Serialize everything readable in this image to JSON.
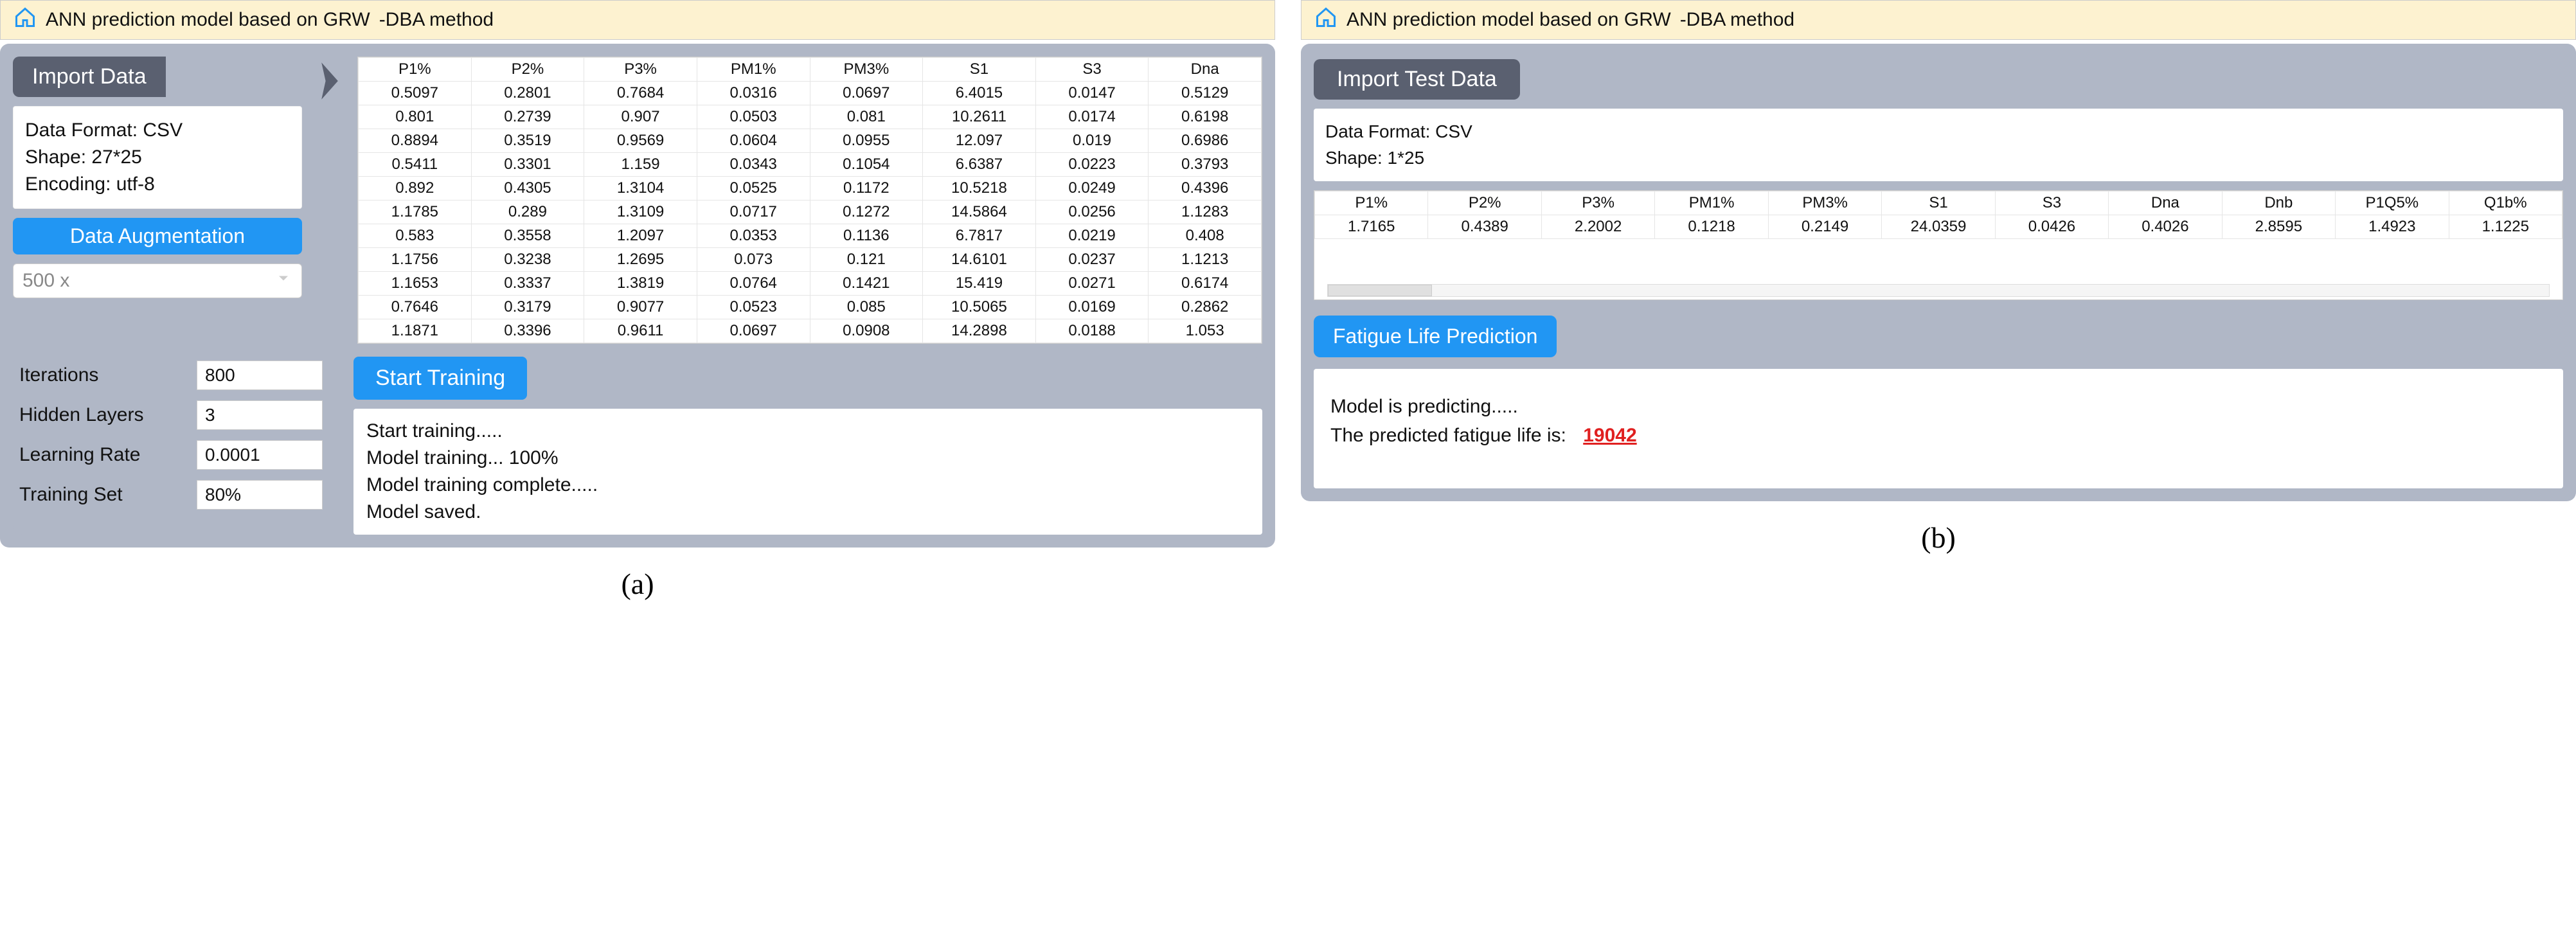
{
  "titlebarA": {
    "prefix": "ANN prediction model based on GRW",
    "suffix": "-DBA method"
  },
  "titlebarB": {
    "prefix": "ANN prediction model based on GRW",
    "suffix": "-DBA method"
  },
  "panelA": {
    "import_btn": "Import Data",
    "info": {
      "format_label": "Data Format: ",
      "format_value": "CSV",
      "shape_label": "Shape: ",
      "shape_value": "27*25",
      "encoding_label": "Encoding: ",
      "encoding_value": "utf-8"
    },
    "augment_btn": "Data Augmentation",
    "augment_value": "500 x",
    "table": {
      "headers": [
        "P1%",
        "P2%",
        "P3%",
        "PM1%",
        "PM3%",
        "S1",
        "S3",
        "Dna"
      ],
      "rows": [
        [
          "0.5097",
          "0.2801",
          "0.7684",
          "0.0316",
          "0.0697",
          "6.4015",
          "0.0147",
          "0.5129"
        ],
        [
          "0.801",
          "0.2739",
          "0.907",
          "0.0503",
          "0.081",
          "10.2611",
          "0.0174",
          "0.6198"
        ],
        [
          "0.8894",
          "0.3519",
          "0.9569",
          "0.0604",
          "0.0955",
          "12.097",
          "0.019",
          "0.6986"
        ],
        [
          "0.5411",
          "0.3301",
          "1.159",
          "0.0343",
          "0.1054",
          "6.6387",
          "0.0223",
          "0.3793"
        ],
        [
          "0.892",
          "0.4305",
          "1.3104",
          "0.0525",
          "0.1172",
          "10.5218",
          "0.0249",
          "0.4396"
        ],
        [
          "1.1785",
          "0.289",
          "1.3109",
          "0.0717",
          "0.1272",
          "14.5864",
          "0.0256",
          "1.1283"
        ],
        [
          "0.583",
          "0.3558",
          "1.2097",
          "0.0353",
          "0.1136",
          "6.7817",
          "0.0219",
          "0.408"
        ],
        [
          "1.1756",
          "0.3238",
          "1.2695",
          "0.073",
          "0.121",
          "14.6101",
          "0.0237",
          "1.1213"
        ],
        [
          "1.1653",
          "0.3337",
          "1.3819",
          "0.0764",
          "0.1421",
          "15.419",
          "0.0271",
          "0.6174"
        ],
        [
          "0.7646",
          "0.3179",
          "0.9077",
          "0.0523",
          "0.085",
          "10.5065",
          "0.0169",
          "0.2862"
        ],
        [
          "1.1871",
          "0.3396",
          "0.9611",
          "0.0697",
          "0.0908",
          "14.2898",
          "0.0188",
          "1.053"
        ]
      ]
    },
    "params": {
      "iterations_label": "Iterations",
      "iterations_value": "800",
      "hidden_label": "Hidden Layers",
      "hidden_value": "3",
      "lr_label": "Learning Rate",
      "lr_value": "0.0001",
      "trainset_label": "Training Set",
      "trainset_value": "80%"
    },
    "start_btn": "Start Training",
    "log": {
      "l1": "Start training.....",
      "l2": "Model training... 100%",
      "l3": "Model training complete.....",
      "l4": "Model saved."
    }
  },
  "panelB": {
    "import_btn": "Import Test Data",
    "info": {
      "format_label": "Data Format: ",
      "format_value": "CSV",
      "shape_label": "Shape: ",
      "shape_value": "1*25"
    },
    "table": {
      "headers": [
        "P1%",
        "P2%",
        "P3%",
        "PM1%",
        "PM3%",
        "S1",
        "S3",
        "Dna",
        "Dnb",
        "P1Q5%",
        "Q1b%"
      ],
      "rows": [
        [
          "1.7165",
          "0.4389",
          "2.2002",
          "0.1218",
          "0.2149",
          "24.0359",
          "0.0426",
          "0.4026",
          "2.8595",
          "1.4923",
          "1.1225"
        ]
      ]
    },
    "predict_btn": "Fatigue Life Prediction",
    "output": {
      "l1": "Model is predicting.....",
      "l2_prefix": "The predicted fatigue life is:",
      "l2_value": "19042"
    }
  },
  "captions": {
    "a": "(a)",
    "b": "(b)"
  }
}
